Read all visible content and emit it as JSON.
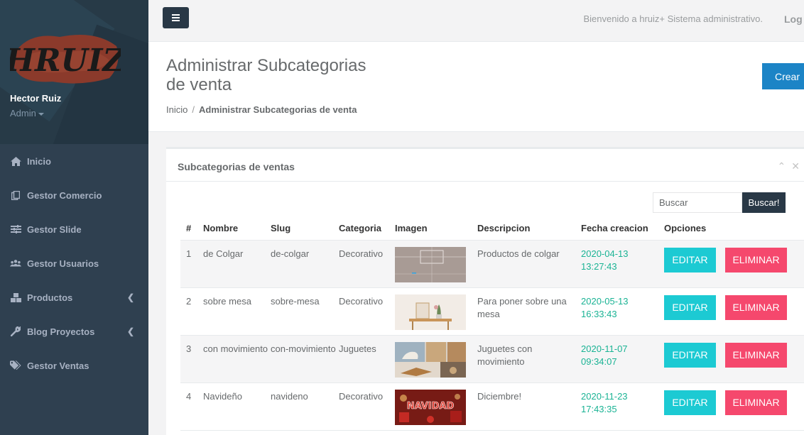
{
  "user": {
    "name": "Hector Ruiz",
    "role": "Admin"
  },
  "logo": {
    "text": "HRUIZ",
    "color": "#8b3a2b"
  },
  "sidebar": {
    "items": [
      {
        "label": "Inicio",
        "icon": "home-icon",
        "has_arrow": false
      },
      {
        "label": "Gestor Comercio",
        "icon": "copy-icon",
        "has_arrow": false
      },
      {
        "label": "Gestor Slide",
        "icon": "sliders-icon",
        "has_arrow": false
      },
      {
        "label": "Gestor Usuarios",
        "icon": "users-icon",
        "has_arrow": false
      },
      {
        "label": "Productos",
        "icon": "cubes-icon",
        "has_arrow": true
      },
      {
        "label": "Blog Proyectos",
        "icon": "wrench-icon",
        "has_arrow": true
      },
      {
        "label": "Gestor Ventas",
        "icon": "tags-icon",
        "has_arrow": false
      }
    ]
  },
  "topbar": {
    "welcome": "Bienvenido a hruiz+ Sistema administrativo.",
    "logout": "Log"
  },
  "heading": {
    "title": "Administrar Subcategorias de venta",
    "breadcrumb_home": "Inicio",
    "breadcrumb_separator": "/",
    "breadcrumb_active": "Administrar Subcategorias de venta",
    "create_button": "Crear"
  },
  "panel": {
    "title": "Subcategorias de ventas"
  },
  "search": {
    "placeholder": "Buscar",
    "button": "Buscar!"
  },
  "table": {
    "headers": [
      "#",
      "Nombre",
      "Slug",
      "Categoria",
      "Imagen",
      "Descripcion",
      "Fecha creacion",
      "Opciones"
    ],
    "rows": [
      {
        "num": "1",
        "nombre": "de Colgar",
        "slug": "de-colgar",
        "categoria": "Decorativo",
        "descripcion": "Productos de colgar",
        "fecha": "2020-04-13 13:27:43",
        "edit": "EDITAR",
        "delete": "ELIMINAR",
        "image": "wall-frame-image"
      },
      {
        "num": "2",
        "nombre": "sobre mesa",
        "slug": "sobre-mesa",
        "categoria": "Decorativo",
        "descripcion": "Para poner sobre una mesa",
        "fecha": "2020-05-13 16:33:43",
        "edit": "EDITAR",
        "delete": "ELIMINAR",
        "image": "table-decor-image"
      },
      {
        "num": "3",
        "nombre": "con movimiento",
        "slug": "con-movimiento",
        "categoria": "Juguetes",
        "descripcion": "Juguetes con movimiento",
        "fecha": "2020-11-07 09:34:07",
        "edit": "EDITAR",
        "delete": "ELIMINAR",
        "image": "wooden-toys-image"
      },
      {
        "num": "4",
        "nombre": "Navideño",
        "slug": "navideno",
        "categoria": "Decorativo",
        "descripcion": "Diciembre!",
        "fecha": "2020-11-23 17:43:35",
        "edit": "EDITAR",
        "delete": "ELIMINAR",
        "image": "navidad-image",
        "image_text": "NAVIDAD"
      }
    ]
  },
  "colors": {
    "sidebar": "#2f4050",
    "accent_green": "#1ab394",
    "edit": "#1ccad3",
    "delete": "#f5486d",
    "primary": "#1c84c6"
  }
}
